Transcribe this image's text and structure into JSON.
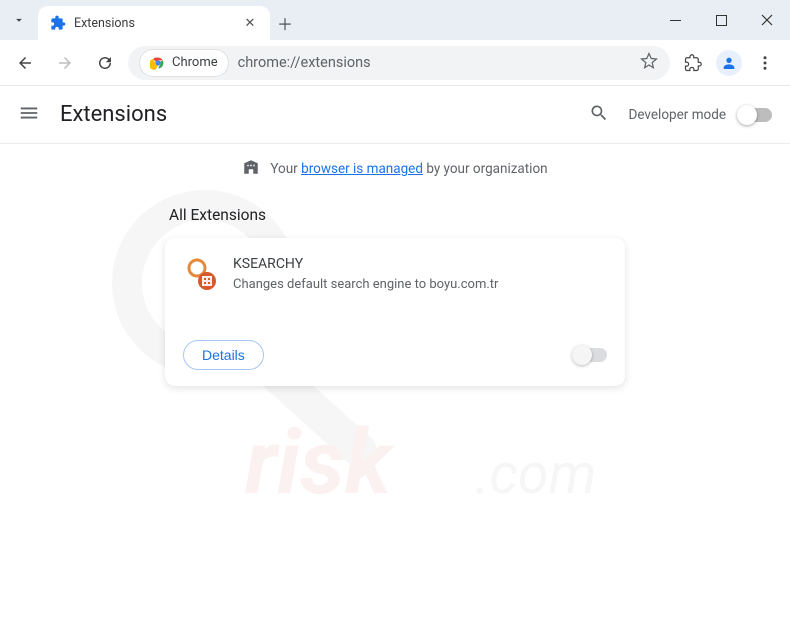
{
  "window": {
    "tab_title": "Extensions"
  },
  "toolbar": {
    "chip_label": "Chrome",
    "url": "chrome://extensions"
  },
  "page": {
    "title": "Extensions",
    "developer_mode_label": "Developer mode",
    "managed_prefix": "Your ",
    "managed_link": "browser is managed",
    "managed_suffix": " by your organization"
  },
  "section": {
    "title": "All Extensions"
  },
  "extension": {
    "name": "KSEARCHY",
    "description": "Changes default search engine to boyu.com.tr",
    "details_label": "Details",
    "enabled": false
  }
}
